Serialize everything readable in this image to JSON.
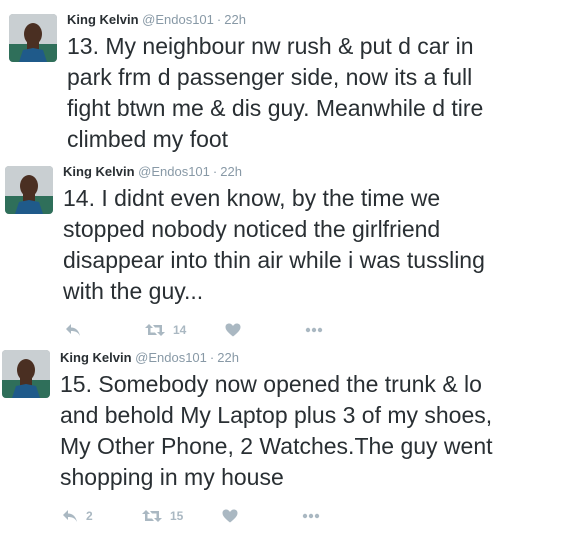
{
  "tweets": [
    {
      "author": "King Kelvin",
      "handle": "@Endos101",
      "separator": "·",
      "time": "22h",
      "lines": [
        "13. My neighbour nw rush & put d car in",
        "park frm d passenger side, now its a full",
        "fight btwn me & dis guy. Meanwhile d tire",
        "climbed my foot"
      ]
    },
    {
      "author": "King Kelvin",
      "handle": "@Endos101",
      "separator": "·",
      "time": "22h",
      "lines": [
        "14. I didnt even know, by the time we",
        "stopped nobody noticed the girlfriend",
        "disappear into thin air while i was tussling",
        "with the guy..."
      ],
      "actions": {
        "reply_count": "",
        "retweet_count": "14",
        "like_count": ""
      }
    },
    {
      "author": "King Kelvin",
      "handle": "@Endos101",
      "separator": "·",
      "time": "22h",
      "lines": [
        "15. Somebody now opened the trunk & lo",
        "and behold My Laptop plus 3 of my shoes,",
        "My Other Phone, 2 Watches.The guy went",
        "shopping in my house"
      ],
      "actions": {
        "reply_count": "2",
        "retweet_count": "15",
        "like_count": ""
      }
    }
  ],
  "icons": {
    "reply": "reply-icon",
    "retweet": "retweet-icon",
    "like": "heart-icon",
    "more": "more-icon"
  },
  "colors": {
    "text": "#292f33",
    "meta": "#8899a6",
    "action": "#aab8c2"
  }
}
